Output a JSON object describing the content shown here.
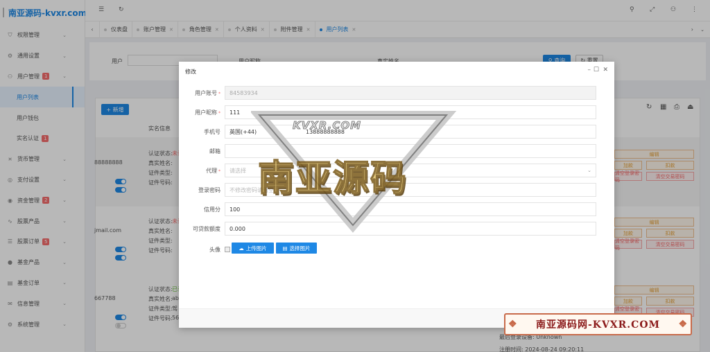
{
  "brand": {
    "name": "南亚源码-kvxr.com"
  },
  "sidebar": {
    "items": [
      {
        "label": "权限管理",
        "icon": "shield-icon"
      },
      {
        "label": "通用设置",
        "icon": "gear-icon"
      },
      {
        "label": "用户管理",
        "icon": "user-icon",
        "badge": "1"
      },
      {
        "label": "用户列表",
        "sub": true,
        "active": true
      },
      {
        "label": "用户钱包",
        "sub": true
      },
      {
        "label": "实名认证",
        "sub": true,
        "badge": "1"
      },
      {
        "label": "货币管理",
        "icon": "currency-icon"
      },
      {
        "label": "支付设置",
        "icon": "payment-icon"
      },
      {
        "label": "资金管理",
        "icon": "fund-icon",
        "badge": "2"
      },
      {
        "label": "股票产品",
        "icon": "stock-icon"
      },
      {
        "label": "股票订单",
        "icon": "order-icon",
        "badge": "5"
      },
      {
        "label": "基金产品",
        "icon": "fund-product-icon"
      },
      {
        "label": "基金订单",
        "icon": "fund-order-icon"
      },
      {
        "label": "信息管理",
        "icon": "message-icon"
      },
      {
        "label": "系统管理",
        "icon": "system-icon"
      }
    ]
  },
  "tabs": [
    {
      "label": "仪表盘"
    },
    {
      "label": "账户管理"
    },
    {
      "label": "角色管理"
    },
    {
      "label": "个人资料"
    },
    {
      "label": "附件管理"
    },
    {
      "label": "用户列表",
      "active": true
    }
  ],
  "search": {
    "user_label": "用户",
    "nickname_label": "用户昵称",
    "realname_label": "真实姓名",
    "query_button": "查询",
    "reset_button": "重置"
  },
  "table": {
    "add_button": "新增",
    "col_verify": "实名信息",
    "rows": [
      {
        "account": "88888888",
        "status_label": "认证状态:",
        "status": "未认",
        "name_label": "真实姓名:",
        "idtype_label": "证件类型:",
        "idno_label": "证件号码:"
      },
      {
        "account": "jmail.com",
        "status_label": "认证状态:",
        "status": "未认",
        "name_label": "真实姓名:",
        "idtype_label": "证件类型:",
        "idno_label": "证件号码:"
      },
      {
        "account": "667788",
        "status_label": "认证状态:",
        "status": "已认",
        "name_label": "真实姓名:",
        "name_value": "abc",
        "idtype_label": "证件类型:",
        "idtype_value": "驾",
        "idno_label": "证件号码:",
        "idno_value": "56"
      }
    ],
    "edit": "编辑",
    "add_funds": "加款",
    "deduct": "扣款",
    "clear_login_pwd": "清空登录密码",
    "clear_trade_pwd": "清空交易密码",
    "last_login_device": "最后登录设备: Unknown",
    "register_time": "注册时间: 2024-08-24 09:20:11"
  },
  "dialog": {
    "title": "修改",
    "fields": {
      "account_label": "用户账号",
      "account_value": "84583934",
      "nickname_label": "用户昵称",
      "nickname_value": "111",
      "phone_label": "手机号",
      "phone_country": "英国(+44)",
      "phone_value": "13888888888",
      "email_label": "邮箱",
      "agent_label": "代理",
      "agent_placeholder": "请选择",
      "password_label": "登录密码",
      "password_placeholder": "不修改密码请留空",
      "credit_label": "信用分",
      "credit_value": "100",
      "loan_label": "可贷款额度",
      "loan_value": "0.000",
      "avatar_label": "头像",
      "upload_button": "上传图片",
      "choose_button": "选择图片"
    }
  },
  "watermarks": {
    "center_big": "南亚源码",
    "center_small": "KVXR.COM",
    "corner": "南亚源码网-KVXR.COM"
  }
}
